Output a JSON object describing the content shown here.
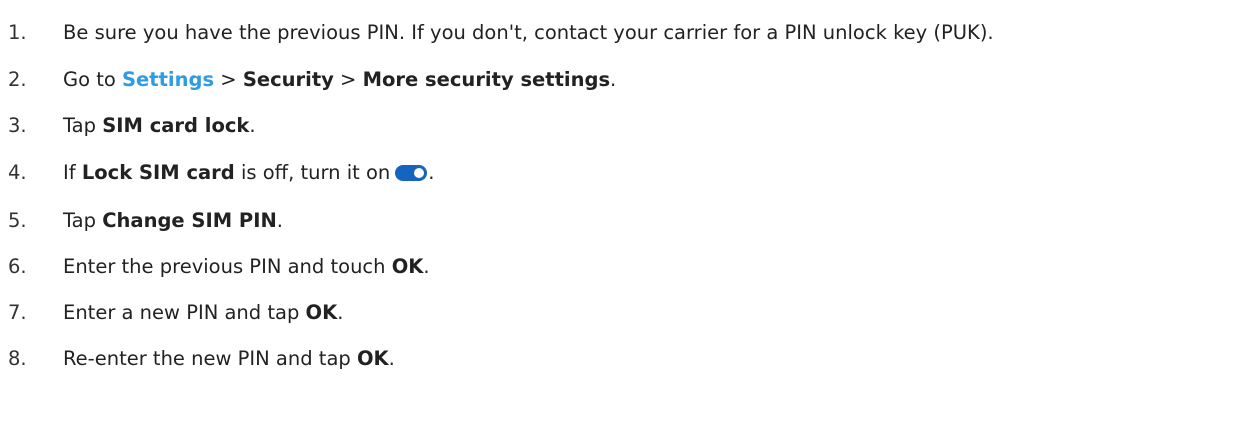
{
  "steps": [
    {
      "num": "1.",
      "text": "Be sure you have the previous PIN. If you don't, contact your carrier for a PIN unlock key (PUK)."
    },
    {
      "num": "2.",
      "pre": "Go to ",
      "link": "Settings",
      "sep1": " > ",
      "b1": "Security",
      "sep2": " > ",
      "b2": "More security settings",
      "post": "."
    },
    {
      "num": "3.",
      "pre": "Tap ",
      "b1": "SIM card lock",
      "post": "."
    },
    {
      "num": "4.",
      "pre": "If ",
      "b1": "Lock SIM card",
      "mid": " is off, turn it on",
      "post": ".",
      "icon": "toggle-on-icon",
      "toggle_color": "#1565c0"
    },
    {
      "num": "5.",
      "pre": "Tap ",
      "b1": "Change SIM PIN",
      "post": "."
    },
    {
      "num": "6.",
      "pre": "Enter the previous PIN and touch ",
      "b1": "OK",
      "post": "."
    },
    {
      "num": "7.",
      "pre": "Enter a new PIN and tap ",
      "b1": "OK",
      "post": "."
    },
    {
      "num": "8.",
      "pre": "Re-enter the new PIN and tap ",
      "b1": "OK",
      "post": "."
    }
  ],
  "colors": {
    "link": "#2e9be6",
    "text": "#222222"
  }
}
